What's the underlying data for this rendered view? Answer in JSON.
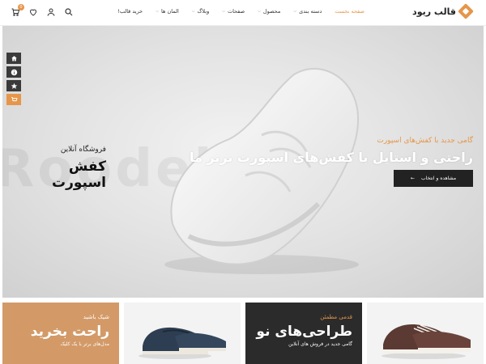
{
  "header": {
    "logo_text": "قالب ریود",
    "nav": [
      {
        "label": "صفحه نخست",
        "active": true,
        "caret": false
      },
      {
        "label": "دسته بندی",
        "active": false,
        "caret": true
      },
      {
        "label": "محصول",
        "active": false,
        "caret": true
      },
      {
        "label": "صفحات",
        "active": false,
        "caret": true
      },
      {
        "label": "وبلاگ",
        "active": false,
        "caret": true
      },
      {
        "label": "المان ها",
        "active": false,
        "caret": true
      },
      {
        "label": "خرید قالب!",
        "active": false,
        "caret": false
      }
    ],
    "cart_count": "0",
    "icons": [
      "search-icon",
      "user-icon",
      "heart-icon",
      "cart-icon"
    ]
  },
  "sidebar_tools": [
    "home-icon",
    "info-icon",
    "star-icon",
    "cart-icon"
  ],
  "hero": {
    "watermark": "Roodellaro",
    "left_subtitle": "فروشگاه آنلاین",
    "left_title": "کفش اسپورت",
    "subtitle": "گامی جدید با کفش‌های اسپورت",
    "title": "راحتی و استایل با کفش‌های اسپورت برتر ما",
    "button_label": "مشاهده و انتخاب"
  },
  "banners": [
    {
      "sub": "شیک باشید",
      "title": "راحت بخرید",
      "small": "مدل‌های برتر با یک کلیک"
    },
    {
      "sub": "",
      "title": "",
      "small": ""
    },
    {
      "sub": "قدمی مطمئن",
      "title": "طراحی‌های نو",
      "small": "گامی جدید در فروش های آنلاین"
    },
    {
      "sub": "",
      "title": "",
      "small": ""
    }
  ],
  "colors": {
    "accent": "#e6964a",
    "dark": "#222222",
    "banner_orange": "#d39a68"
  }
}
